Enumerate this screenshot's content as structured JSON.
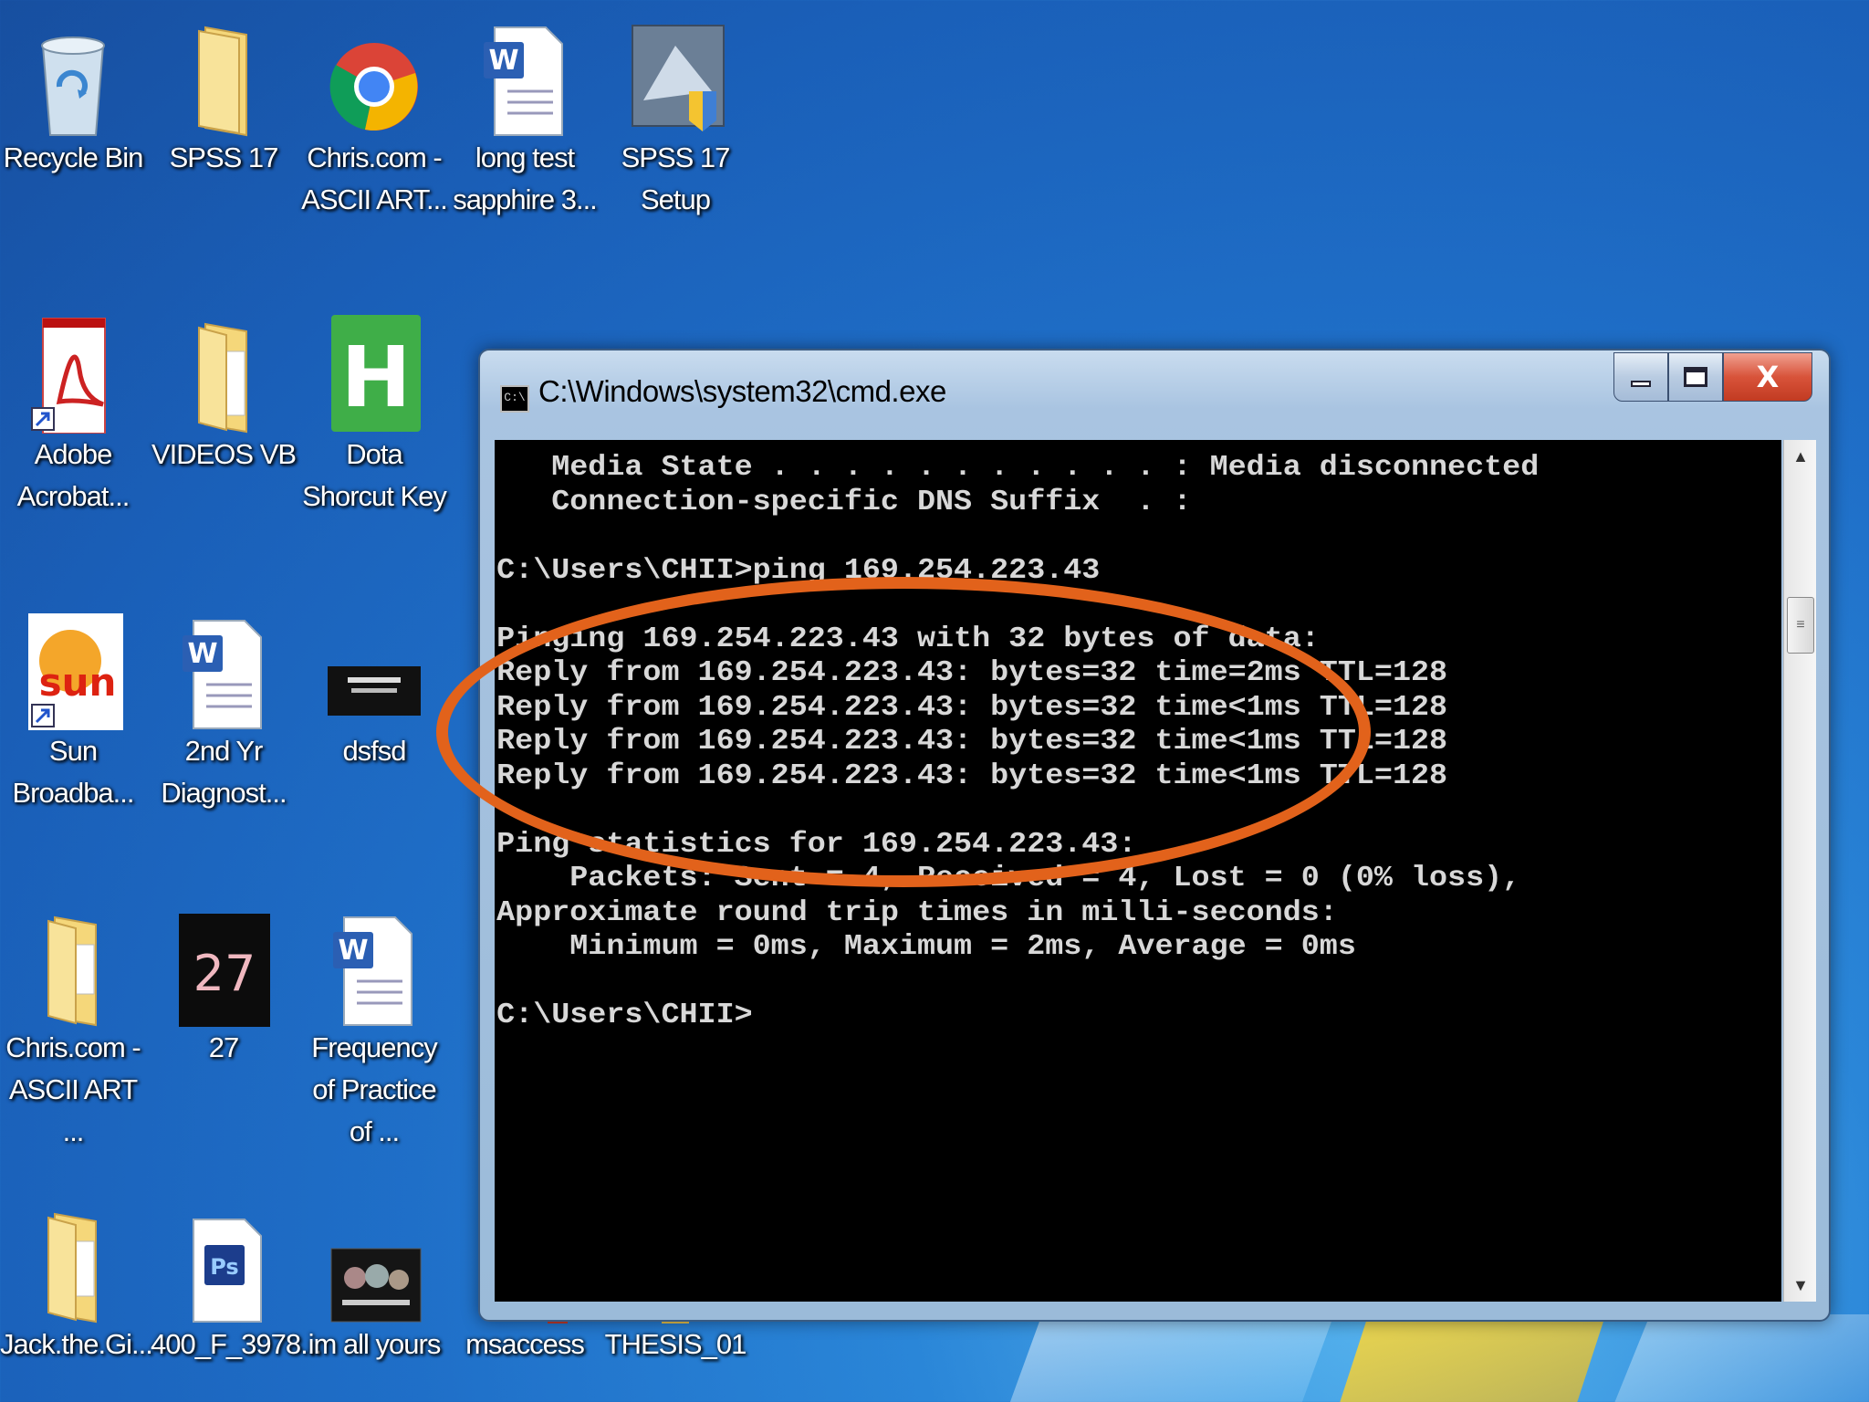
{
  "desktop": {
    "icons": [
      {
        "label": "Recycle Bin",
        "icon": "recycle-bin-icon"
      },
      {
        "label": "SPSS 17",
        "icon": "folder-icon"
      },
      {
        "label": "Chris.com - ASCII ART...",
        "icon": "chrome-icon"
      },
      {
        "label": "long test sapphire 3...",
        "icon": "word-document-icon"
      },
      {
        "label": "SPSS 17 Setup",
        "icon": "setup-icon"
      },
      {
        "label": "Adobe Acrobat...",
        "icon": "adobe-acrobat-icon"
      },
      {
        "label": "VIDEOS VB",
        "icon": "folder-icon"
      },
      {
        "label": "Dota Shorcut Key",
        "icon": "hotkey-icon"
      },
      {
        "label": "Sun Broadba...",
        "icon": "sun-broadband-icon"
      },
      {
        "label": "2nd Yr Diagnost...",
        "icon": "word-document-icon"
      },
      {
        "label": "dsfsd",
        "icon": "image-thumbnail-icon"
      },
      {
        "label": "Chris.com - ASCII ART ...",
        "icon": "folder-icon"
      },
      {
        "label": "27",
        "icon": "calendar-27-icon"
      },
      {
        "label": "Frequency of Practice of ...",
        "icon": "word-document-icon"
      },
      {
        "label": "Jack.the.Gi...",
        "icon": "folder-icon"
      },
      {
        "label": "400_F_3978...",
        "icon": "photoshop-icon"
      },
      {
        "label": "im all yours",
        "icon": "image-thumbnail-icon"
      },
      {
        "label": "msaccess",
        "icon": "access-icon"
      },
      {
        "label": "THESIS_01",
        "icon": "folder-icon"
      }
    ]
  },
  "cmd": {
    "title": "C:\\Windows\\system32\\cmd.exe",
    "system_icon_text": "C:\\",
    "close_label": "X",
    "lines": [
      "   Media State . . . . . . . . . . . : Media disconnected",
      "   Connection-specific DNS Suffix  . :",
      "",
      "C:\\Users\\CHII>ping 169.254.223.43",
      "",
      "Pinging 169.254.223.43 with 32 bytes of data:",
      "Reply from 169.254.223.43: bytes=32 time=2ms TTL=128",
      "Reply from 169.254.223.43: bytes=32 time<1ms TTL=128",
      "Reply from 169.254.223.43: bytes=32 time<1ms TTL=128",
      "Reply from 169.254.223.43: bytes=32 time<1ms TTL=128",
      "",
      "Ping statistics for 169.254.223.43:",
      "    Packets: Sent = 4, Received = 4, Lost = 0 (0% loss),",
      "Approximate round trip times in milli-seconds:",
      "    Minimum = 0ms, Maximum = 2ms, Average = 0ms",
      "",
      "C:\\Users\\CHII>"
    ]
  },
  "colors": {
    "highlight": "#e2621b",
    "console_bg": "#000000",
    "console_fg": "#d8d8d8"
  }
}
